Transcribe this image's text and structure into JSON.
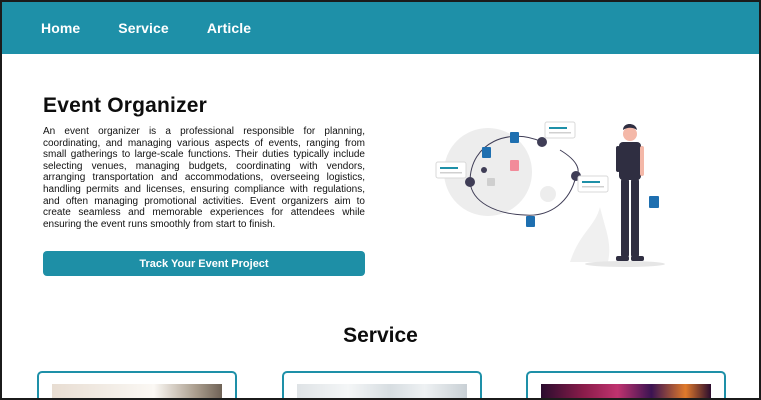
{
  "nav": {
    "items": [
      {
        "label": "Home"
      },
      {
        "label": "Service"
      },
      {
        "label": "Article"
      }
    ]
  },
  "hero": {
    "title": "Event Organizer",
    "description": "An event organizer is a professional responsible for planning, coordinating, and managing various aspects of events, ranging from small gatherings to large-scale functions. Their duties typically include selecting venues, managing budgets, coordinating with vendors, arranging transportation and accommodations, overseeing logistics, handling permits and licenses, ensuring compliance with regulations, and often managing promotional activities. Event organizers aim to create seamless and memorable experiences for attendees while ensuring the event runs smoothly from start to finish.",
    "cta_label": "Track Your Event Project"
  },
  "service": {
    "title": "Service"
  },
  "colors": {
    "brand": "#1e90a8",
    "nav_text": "#ffffff",
    "figure_dark": "#2f2e41"
  }
}
